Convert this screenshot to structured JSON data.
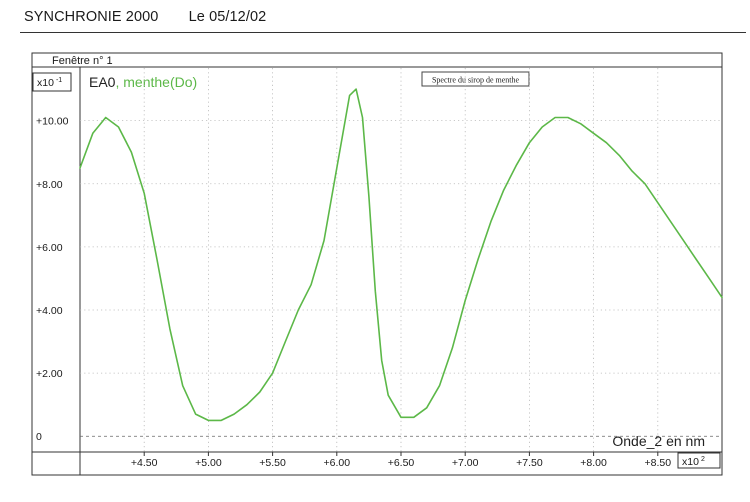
{
  "header": {
    "app_title": "SYNCHRONIE 2000",
    "date_label": "Le 05/12/02"
  },
  "window": {
    "title": "Fenêtre n° 1"
  },
  "chart_data": {
    "type": "line",
    "series": [
      {
        "name": "EA0",
        "label_suffix": ", menthe(Do)",
        "color": "#5cb848",
        "x": [
          400,
          410,
          420,
          430,
          440,
          450,
          460,
          470,
          480,
          490,
          500,
          510,
          520,
          530,
          540,
          550,
          560,
          570,
          580,
          590,
          600,
          610,
          615,
          620,
          625,
          630,
          635,
          640,
          650,
          660,
          670,
          680,
          690,
          700,
          710,
          720,
          730,
          740,
          750,
          760,
          770,
          780,
          790,
          800,
          810,
          820,
          830,
          840,
          850,
          860,
          870,
          880,
          890,
          900
        ],
        "y": [
          8.5,
          9.6,
          10.1,
          9.8,
          9.0,
          7.7,
          5.6,
          3.4,
          1.6,
          0.7,
          0.5,
          0.5,
          0.7,
          1.0,
          1.4,
          2.0,
          3.0,
          4.0,
          4.8,
          6.2,
          8.5,
          10.8,
          11.0,
          10.1,
          7.6,
          4.6,
          2.4,
          1.3,
          0.6,
          0.6,
          0.9,
          1.6,
          2.8,
          4.3,
          5.6,
          6.8,
          7.8,
          8.6,
          9.3,
          9.8,
          10.1,
          10.1,
          9.9,
          9.6,
          9.3,
          8.9,
          8.4,
          8.0,
          7.4,
          6.8,
          6.2,
          5.6,
          5.0,
          4.4
        ]
      }
    ],
    "annotation": "Spectre du sirop de menthe",
    "y_multiplier_label": "x10",
    "y_multiplier_exp": "-1",
    "x_multiplier_label": "x10",
    "x_multiplier_exp": "2",
    "xlabel": "Onde_2 en nm",
    "x_ticks": [
      {
        "v": 450,
        "label": "+4.50"
      },
      {
        "v": 500,
        "label": "+5.00"
      },
      {
        "v": 550,
        "label": "+5.50"
      },
      {
        "v": 600,
        "label": "+6.00"
      },
      {
        "v": 650,
        "label": "+6.50"
      },
      {
        "v": 700,
        "label": "+7.00"
      },
      {
        "v": 750,
        "label": "+7.50"
      },
      {
        "v": 800,
        "label": "+8.00"
      },
      {
        "v": 850,
        "label": "+8.50"
      }
    ],
    "y_ticks": [
      {
        "v": 0,
        "label": "0"
      },
      {
        "v": 2,
        "label": "+2.00"
      },
      {
        "v": 4,
        "label": "+4.00"
      },
      {
        "v": 6,
        "label": "+6.00"
      },
      {
        "v": 8,
        "label": "+8.00"
      },
      {
        "v": 10,
        "label": "+10.00"
      }
    ],
    "xlim": [
      400,
      900
    ],
    "ylim": [
      -0.5,
      11.7
    ],
    "grid": true
  }
}
